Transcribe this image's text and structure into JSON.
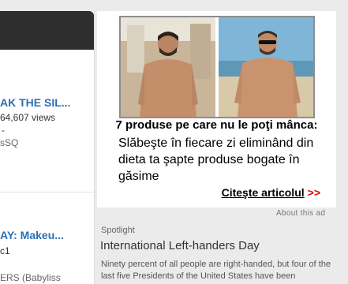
{
  "left": {
    "items": [
      {
        "title": "AK THE SIL...",
        "views": "64,607 views",
        "dash": "-",
        "channel": "sSQ"
      },
      {
        "title": "AY: Makeu...",
        "views": "c1",
        "dash": "",
        "channel": "ERS (Babyliss"
      }
    ]
  },
  "ad": {
    "headline": "7 produse pe care nu le poţi mânca:",
    "body": "Slăbeşte în fiecare zi eliminând din dieta ta şapte produse bogate în găsime",
    "cta": "Citeşte articolul",
    "cta_arrows": ">>",
    "about": "About this ad"
  },
  "spotlight": {
    "label": "Spotlight",
    "title": "International Left-handers Day",
    "description": "Ninety percent of all people are right-handed, but four of the last five Presidents of the United States have been"
  }
}
